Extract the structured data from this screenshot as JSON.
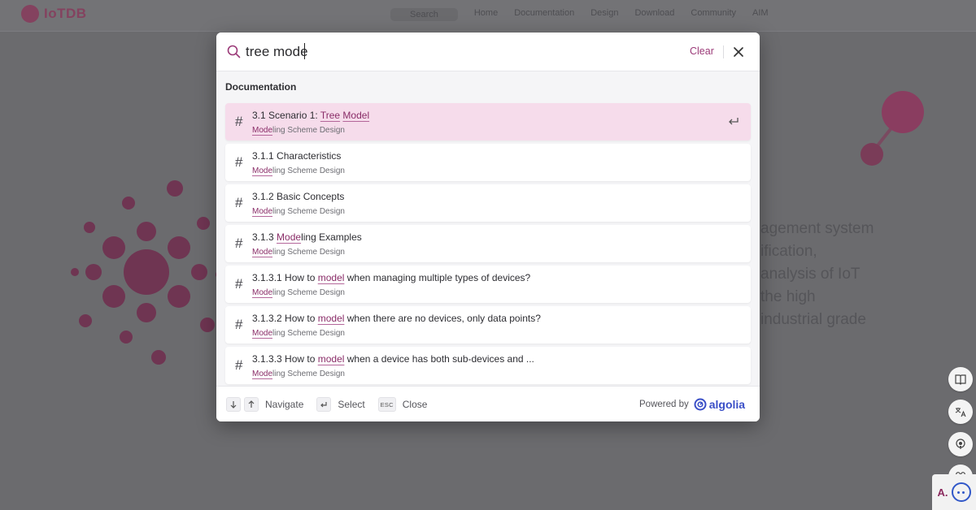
{
  "background": {
    "logo_text": "IoTDB",
    "nav_links": [
      "Search",
      "Home",
      "Documentation",
      "Design",
      "Download",
      "Community",
      "AIM"
    ],
    "hero_lines": [
      "agement system",
      "ification,",
      "analysis of IoT",
      "the high",
      "industrial grade"
    ]
  },
  "search": {
    "query": "tree mode",
    "clear_label": "Clear",
    "section_title": "Documentation",
    "hits": [
      {
        "title_parts": [
          {
            "t": "3.1 Scenario 1: ",
            "h": false
          },
          {
            "t": "Tree",
            "h": true
          },
          {
            "t": " ",
            "h": false
          },
          {
            "t": "Model",
            "h": true
          }
        ],
        "sub_hl": "Mode",
        "sub_rest": "ling Scheme Design",
        "active": true
      },
      {
        "title_parts": [
          {
            "t": "3.1.1 Characteristics",
            "h": false
          }
        ],
        "sub_hl": "Mode",
        "sub_rest": "ling Scheme Design",
        "active": false
      },
      {
        "title_parts": [
          {
            "t": "3.1.2 Basic Concepts",
            "h": false
          }
        ],
        "sub_hl": "Mode",
        "sub_rest": "ling Scheme Design",
        "active": false
      },
      {
        "title_parts": [
          {
            "t": "3.1.3 ",
            "h": false
          },
          {
            "t": "Mode",
            "h": true
          },
          {
            "t": "ling Examples",
            "h": false
          }
        ],
        "sub_hl": "Mode",
        "sub_rest": "ling Scheme Design",
        "active": false
      },
      {
        "title_parts": [
          {
            "t": "3.1.3.1 How to ",
            "h": false
          },
          {
            "t": "model",
            "h": true
          },
          {
            "t": " when managing multiple types of devices?",
            "h": false
          }
        ],
        "sub_hl": "Mode",
        "sub_rest": "ling Scheme Design",
        "active": false
      },
      {
        "title_parts": [
          {
            "t": "3.1.3.2 How to ",
            "h": false
          },
          {
            "t": "model",
            "h": true
          },
          {
            "t": " when there are no devices, only data points?",
            "h": false
          }
        ],
        "sub_hl": "Mode",
        "sub_rest": "ling Scheme Design",
        "active": false
      },
      {
        "title_parts": [
          {
            "t": "3.1.3.3 How to ",
            "h": false
          },
          {
            "t": "model",
            "h": true
          },
          {
            "t": " when a device has both sub-devices and ...",
            "h": false
          }
        ],
        "sub_hl": "Mode",
        "sub_rest": "ling Scheme Design",
        "active": false
      }
    ]
  },
  "footer": {
    "navigate_label": "Navigate",
    "select_label": "Select",
    "esc_key": "ESC",
    "close_label": "Close",
    "powered_by": "Powered by",
    "brand": "algolia"
  },
  "assistant": {
    "label": "A."
  },
  "colors": {
    "accent": "#9b3a78",
    "active_row": "#f6dceb",
    "algolia": "#3a4fc7"
  }
}
